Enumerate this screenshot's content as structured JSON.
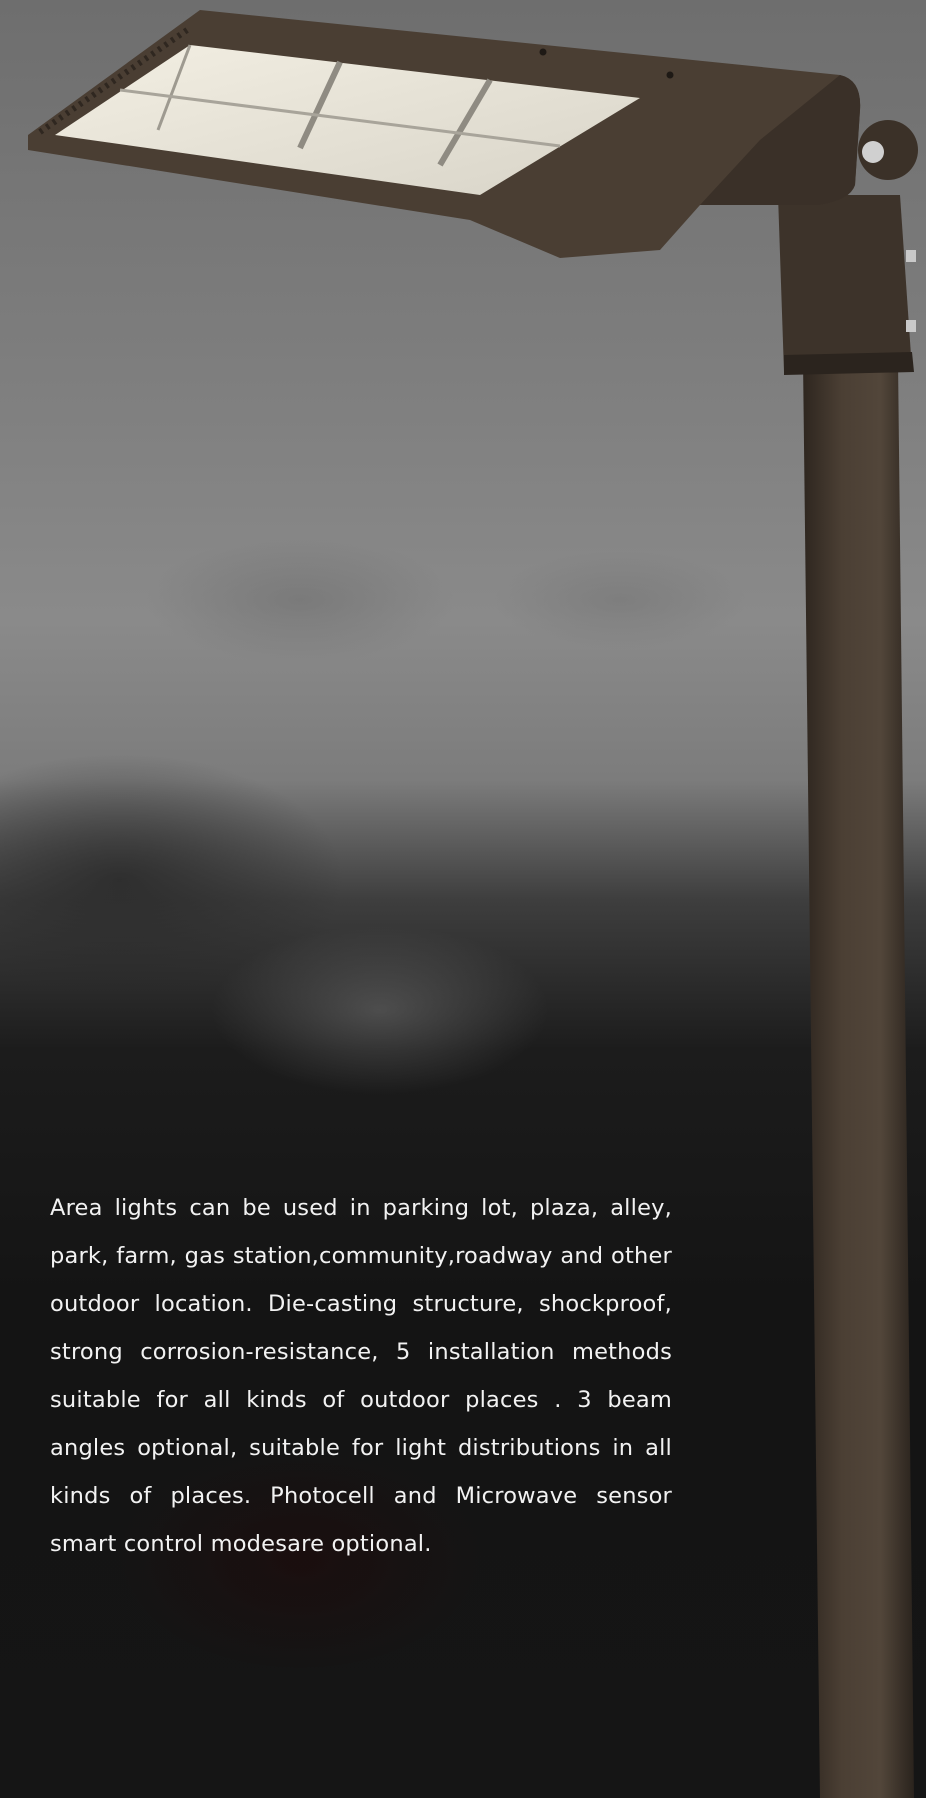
{
  "description_text": "Area lights can be used in parking lot, plaza,  alley, park, farm, gas station,community,roadway and other outdoor location. Die-casting structure, shockproof, strong corrosion-resistance, 5 installation methods suitable for all kinds of outdoor places . 3 beam angles optional, suitable for light distributions in all kinds of places. Photocell and Microwave sensor smart control modesare optional.",
  "colors": {
    "fixture_body": "#4a3e33",
    "led_panel": "#e8e4d8"
  }
}
